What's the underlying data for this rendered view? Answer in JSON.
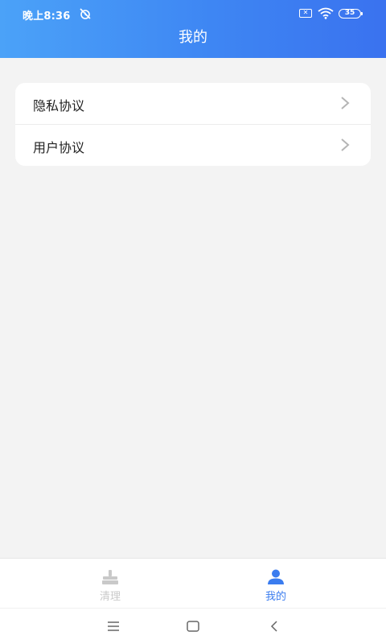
{
  "status_bar": {
    "time": "晚上8:36",
    "battery": "35",
    "sim_label": "✕"
  },
  "header": {
    "title": "我的"
  },
  "menu": {
    "items": [
      {
        "label": "隐私协议"
      },
      {
        "label": "用户协议"
      }
    ]
  },
  "tabbar": {
    "tabs": [
      {
        "label": "清理",
        "icon": "broom-icon",
        "active": false
      },
      {
        "label": "我的",
        "icon": "person-icon",
        "active": true
      }
    ]
  },
  "colors": {
    "accent": "#3a7cef",
    "inactive": "#c9c9c9",
    "header_start": "#4ba2f8",
    "header_end": "#3a72ef"
  },
  "system_nav": {
    "icons": [
      "menu-icon",
      "home-icon",
      "back-icon"
    ]
  }
}
